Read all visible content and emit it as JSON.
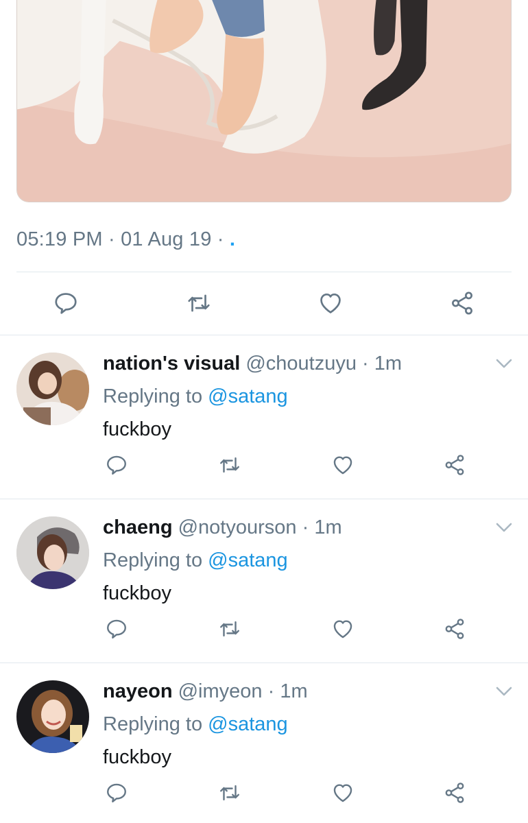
{
  "tweet": {
    "timestamp": "05:19 PM · 01 Aug 19 ·",
    "timestamp_tail": ".",
    "media_alt": "photo of feet on a bed with white sheets and pink blanket"
  },
  "icons": {
    "reply": "reply-icon",
    "retweet": "retweet-icon",
    "like": "heart-icon",
    "share": "share-icon",
    "caret": "chevron-down-icon"
  },
  "colors": {
    "text": "#14171a",
    "secondary": "#657786",
    "link": "#1b95e0",
    "divider": "#e1e8ed",
    "icon": "#657786"
  },
  "replies": [
    {
      "name": "nation's visual",
      "handle": "@choutzuyu",
      "separator": "·",
      "time": "1m",
      "replying_prefix": "Replying to",
      "replying_to": "@satang",
      "text": "fuckboy"
    },
    {
      "name": "chaeng",
      "handle": "@notyourson",
      "separator": "·",
      "time": "1m",
      "replying_prefix": "Replying to",
      "replying_to": "@satang",
      "text": "fuckboy"
    },
    {
      "name": "nayeon",
      "handle": "@imyeon",
      "separator": "·",
      "time": "1m",
      "replying_prefix": "Replying to",
      "replying_to": "@satang",
      "text": "fuckboy"
    }
  ]
}
